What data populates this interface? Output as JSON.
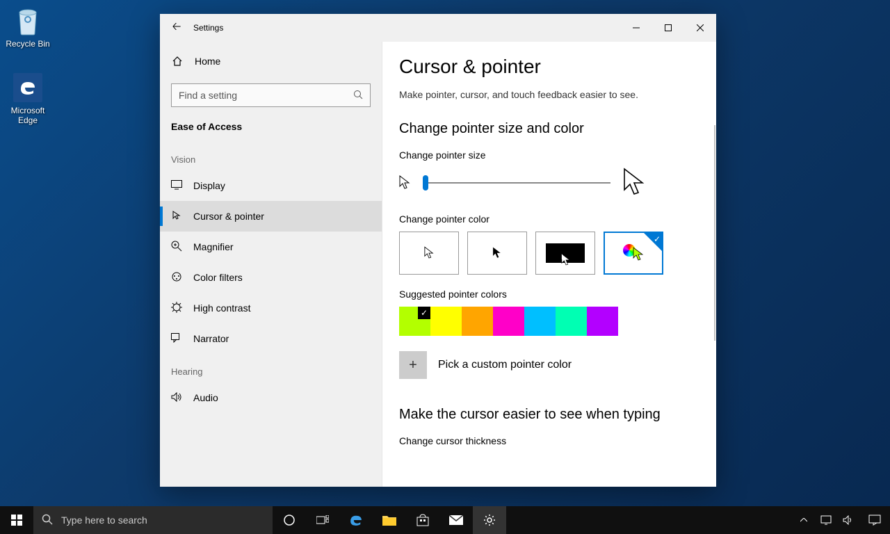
{
  "desktop": {
    "recycle": "Recycle Bin",
    "edge": "Microsoft Edge"
  },
  "window": {
    "title": "Settings",
    "home": "Home",
    "search_placeholder": "Find a setting",
    "sidebar_header": "Ease of Access",
    "cat_vision": "Vision",
    "cat_hearing": "Hearing",
    "items": {
      "display": "Display",
      "cursor": "Cursor & pointer",
      "magnifier": "Magnifier",
      "colorfilters": "Color filters",
      "highcontrast": "High contrast",
      "narrator": "Narrator",
      "audio": "Audio"
    }
  },
  "content": {
    "heading": "Cursor & pointer",
    "subtitle": "Make pointer, cursor, and touch feedback easier to see.",
    "section1": "Change pointer size and color",
    "size_label": "Change pointer size",
    "color_label": "Change pointer color",
    "suggested_label": "Suggested pointer colors",
    "custom_label": "Pick a custom pointer color",
    "section2": "Make the cursor easier to see when typing",
    "thickness_label": "Change cursor thickness",
    "swatches": [
      "#b3ff00",
      "#ffff00",
      "#ffa500",
      "#ff00c8",
      "#00bfff",
      "#00ffb3",
      "#b300ff"
    ]
  },
  "taskbar": {
    "search_placeholder": "Type here to search"
  }
}
